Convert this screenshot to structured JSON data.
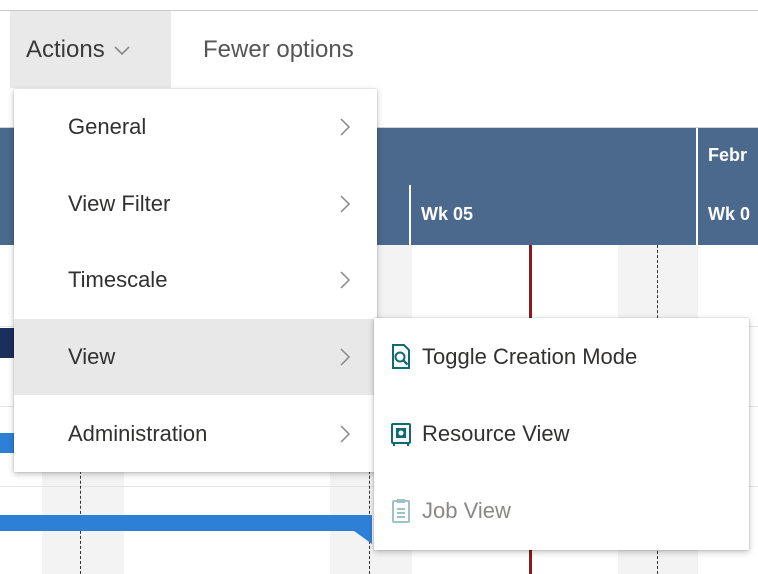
{
  "toolbar": {
    "actions_label": "Actions",
    "fewer_options_label": "Fewer options"
  },
  "timeline": {
    "month_label_partial": "Febr",
    "week_labels": [
      "Wk 05",
      "Wk 0"
    ]
  },
  "menu": {
    "items": [
      {
        "label": "General"
      },
      {
        "label": "View Filter"
      },
      {
        "label": "Timescale"
      },
      {
        "label": "View"
      },
      {
        "label": "Administration"
      }
    ]
  },
  "submenu": {
    "items": [
      {
        "label": "Toggle Creation Mode",
        "icon": "search-document-icon"
      },
      {
        "label": "Resource View",
        "icon": "resource-view-icon"
      },
      {
        "label": "Job View",
        "icon": "clipboard-icon"
      }
    ]
  },
  "colors": {
    "header_band": "#4a698c",
    "icon_teal": "#0f6b73",
    "icon_disabled": "#9cc3c8",
    "today_line": "#8b1a1a",
    "bar_blue": "#2e7fd6"
  }
}
